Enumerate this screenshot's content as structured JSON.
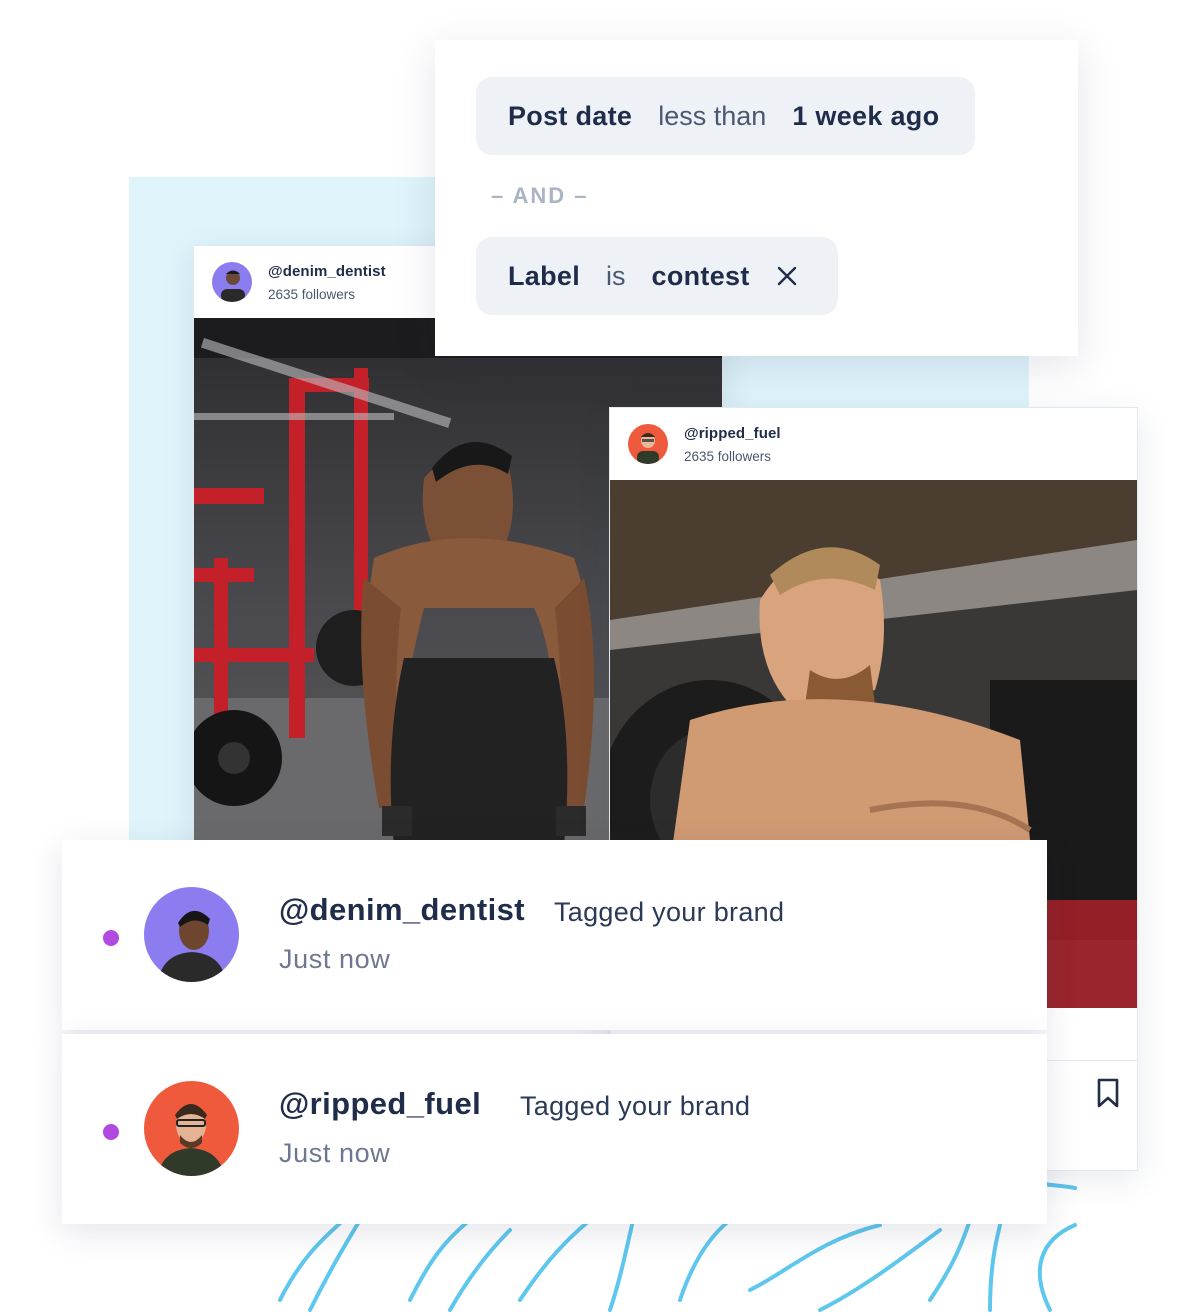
{
  "filters": {
    "chip1": {
      "field": "Post date",
      "operator": "less than",
      "value": "1 week ago"
    },
    "separator": "– AND –",
    "chip2": {
      "field": "Label",
      "operator": "is",
      "value": "contest"
    }
  },
  "posts": [
    {
      "handle": "@denim_dentist",
      "followers": "2635 followers",
      "avatar_color": "#8b7cf0"
    },
    {
      "handle": "@ripped_fuel",
      "followers": "2635 followers",
      "avatar_color": "#f05a3c"
    }
  ],
  "notifications": [
    {
      "handle": "@denim_dentist",
      "action": "Tagged your brand",
      "time": "Just now",
      "avatar_color": "#8b7cf0",
      "dot_color": "#b04ae0"
    },
    {
      "handle": "@ripped_fuel",
      "action": "Tagged your brand",
      "time": "Just now",
      "avatar_color": "#f05a3c",
      "dot_color": "#b04ae0"
    }
  ],
  "icons": [
    "close-icon",
    "bookmark-icon"
  ],
  "colors": {
    "accent_panel": "#dff4fb",
    "chip_bg": "#eef2f7",
    "text": "#1f2d4a"
  }
}
